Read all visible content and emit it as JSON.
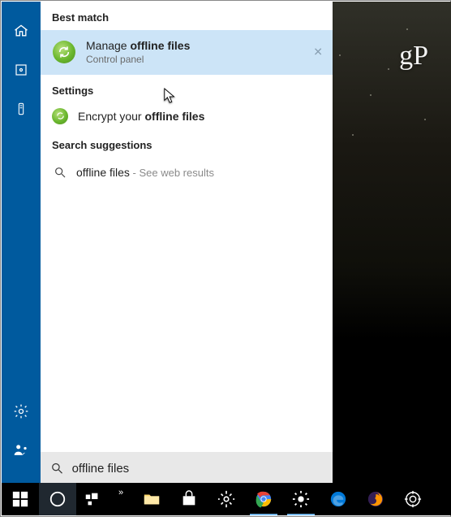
{
  "watermark": "gP",
  "rail": {
    "top": [
      {
        "name": "home-icon"
      },
      {
        "name": "photos-icon"
      },
      {
        "name": "remote-icon"
      }
    ],
    "bottom": [
      {
        "name": "settings-gear-icon"
      },
      {
        "name": "user-feedback-icon"
      }
    ]
  },
  "sections": {
    "best_match": "Best match",
    "settings": "Settings",
    "suggestions": "Search suggestions"
  },
  "best_match_item": {
    "title_html": "Manage <b>offline files</b>",
    "subtitle": "Control panel",
    "close_label": "✕"
  },
  "settings_item": {
    "title_html": "Encrypt your <b>offline files</b>"
  },
  "suggestion": {
    "text": "offline files",
    "hint": " - See web results"
  },
  "search": {
    "icon": "search-icon",
    "value": "offline files"
  },
  "taskbar": [
    {
      "name": "start-button",
      "icon": "windows",
      "running": false
    },
    {
      "name": "cortana-button",
      "icon": "cortana",
      "running": false,
      "active": true
    },
    {
      "name": "task-view-button",
      "icon": "taskview",
      "running": false
    },
    {
      "name": "overflow-chevron",
      "icon": "overflow",
      "running": false
    },
    {
      "name": "file-explorer",
      "icon": "explorer",
      "running": false
    },
    {
      "name": "store",
      "icon": "store",
      "running": false
    },
    {
      "name": "settings-app",
      "icon": "gear",
      "running": false
    },
    {
      "name": "chrome",
      "icon": "chrome",
      "running": true
    },
    {
      "name": "brightness-app",
      "icon": "sun",
      "running": true
    },
    {
      "name": "edge",
      "icon": "edge",
      "running": false
    },
    {
      "name": "firefox",
      "icon": "firefox",
      "running": false
    },
    {
      "name": "screen-capture",
      "icon": "target",
      "running": false
    }
  ]
}
